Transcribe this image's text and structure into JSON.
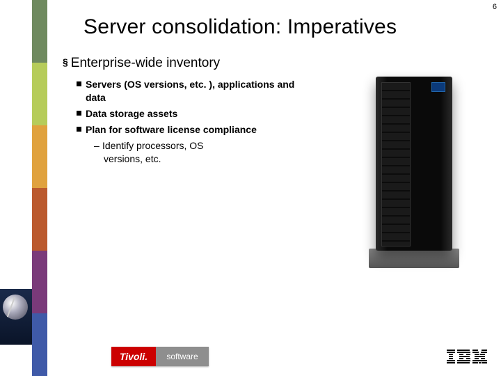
{
  "page_number": "6",
  "title": "Server consolidation: Imperatives",
  "heading": "Enterprise-wide inventory",
  "bullets": [
    "Servers (OS versions, etc. ), applications and data",
    "Data storage assets",
    "Plan for software license compliance"
  ],
  "sub_bullet_line1": "Identify processors, OS",
  "sub_bullet_line2": "versions, etc.",
  "footer": {
    "tivoli_brand": "Tivoli.",
    "tivoli_sub": "software",
    "ibm": "IBM"
  },
  "icons": {
    "sidebar_stripe": "color-stripe",
    "sidebar_dish": "satellite-dish",
    "server_img": "server-rack",
    "ibm_logo": "ibm-logo"
  }
}
